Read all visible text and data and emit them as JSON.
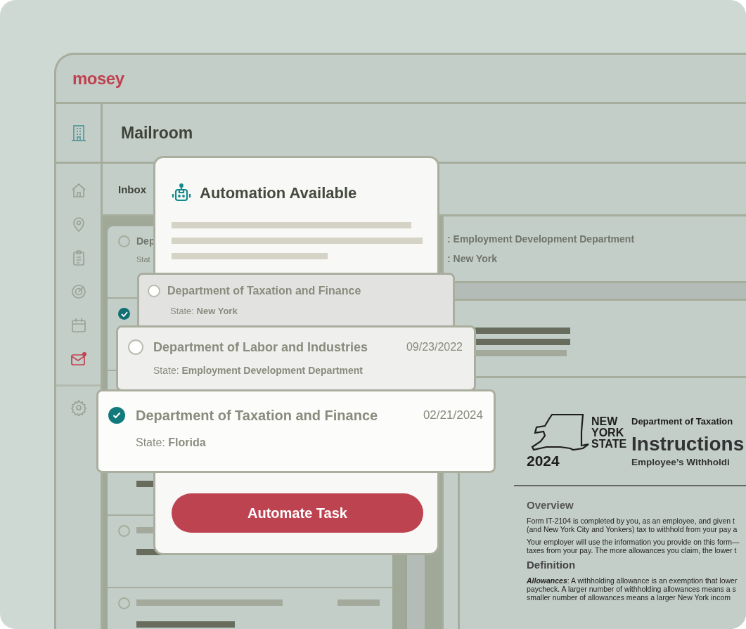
{
  "logo": "mosey",
  "sidebar": {
    "items": [
      {
        "kind": "home",
        "selected": false,
        "notification": false
      },
      {
        "kind": "pin",
        "selected": false,
        "notification": false
      },
      {
        "kind": "clipboard",
        "selected": false,
        "notification": false
      },
      {
        "kind": "target",
        "selected": false,
        "notification": false
      },
      {
        "kind": "calendar",
        "selected": false,
        "notification": false
      },
      {
        "kind": "mail",
        "selected": true,
        "notification": true
      }
    ],
    "footer_items": [
      {
        "kind": "settings",
        "selected": false,
        "notification": false
      }
    ]
  },
  "page_title": "Mailroom",
  "tabs": [
    {
      "label": "Inbox",
      "selected": true
    }
  ],
  "inbox": {
    "rows": [
      {
        "kind": "text",
        "title": "Dep",
        "subtitle": "Stat",
        "selected": false
      },
      {
        "kind": "blank",
        "selected": true
      },
      {
        "kind": "blank"
      },
      {
        "kind": "bar"
      },
      {
        "kind": "placeholder",
        "selected": false
      },
      {
        "kind": "placeholder",
        "selected": false
      }
    ]
  },
  "detail": {
    "lines": [
      ": Employment Development Department",
      ": New York"
    ]
  },
  "document": {
    "logo_lines": [
      "NEW",
      "YORK",
      "STATE"
    ],
    "logo_year": "2024",
    "department": "Department of Taxation",
    "title": "Instructions",
    "subtitle": "Employee’s Withholdi",
    "sections": [
      {
        "heading": "Overview",
        "paragraphs": [
          [
            "Form IT-2104 is completed by you, as an employee, and given t",
            "(and New York City and Yonkers) tax to withhold from your pay a"
          ],
          [
            "Your employer will use the information you provide on this form—",
            "taxes from your pay. The more allowances you claim, the lower t"
          ]
        ]
      },
      {
        "heading": "Definition",
        "paragraphs": [
          [
            "**Allowances**: A withholding allowance is an exemption that lower",
            "paycheck. A larger number of withholding allowances means a s",
            "smaller number of allowances means a larger New York incom"
          ]
        ]
      }
    ]
  },
  "popup": {
    "title": "Automation Available",
    "button": "Automate Task",
    "matches": [
      {
        "title": "Department of Taxation and Finance",
        "state": "State: **New York**",
        "selected": false
      },
      {
        "title": "Department of Labor and Industries",
        "date": "09/23/2022",
        "state": "State: **Employment Development Department**",
        "selected": false
      },
      {
        "title": "Department of Taxation and Finance",
        "date": "02/21/2024",
        "state": "State: **Florida**",
        "selected": true
      }
    ]
  }
}
